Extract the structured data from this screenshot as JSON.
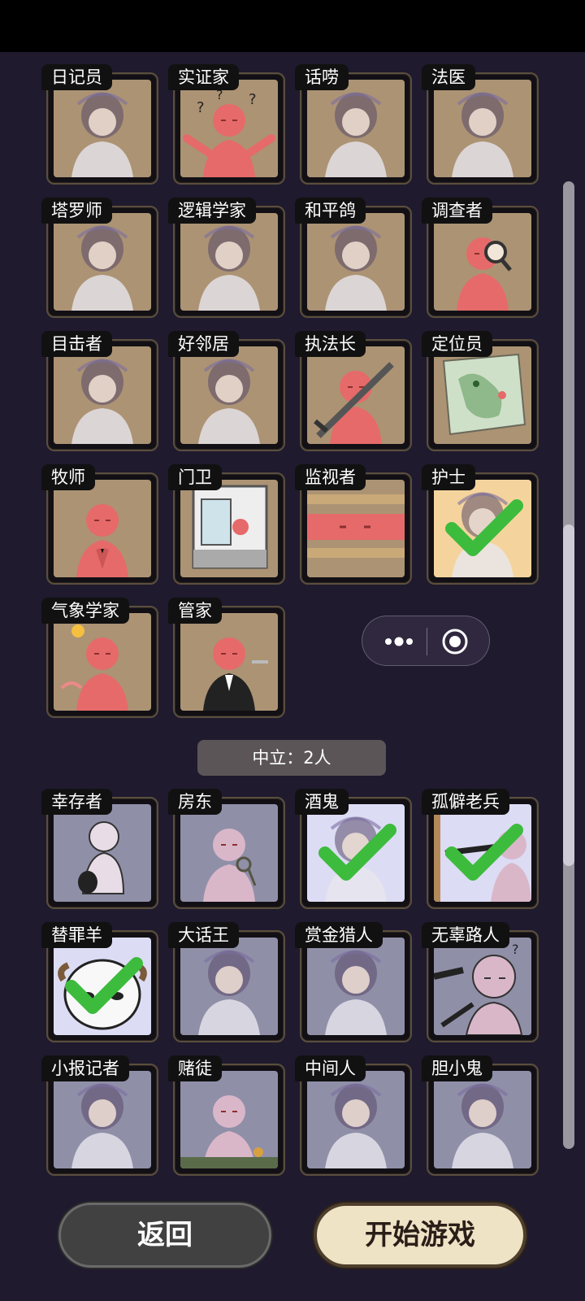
{
  "good_roles": [
    {
      "label": "日记员",
      "picked": false,
      "icon": "portrait-icon"
    },
    {
      "label": "实证家",
      "picked": false,
      "icon": "confused-figure-icon"
    },
    {
      "label": "话唠",
      "picked": false,
      "icon": "portrait-icon"
    },
    {
      "label": "法医",
      "picked": false,
      "icon": "portrait-icon"
    },
    {
      "label": "塔罗师",
      "picked": false,
      "icon": "portrait-icon"
    },
    {
      "label": "逻辑学家",
      "picked": false,
      "icon": "portrait-icon"
    },
    {
      "label": "和平鸽",
      "picked": false,
      "icon": "portrait-icon"
    },
    {
      "label": "调查者",
      "picked": false,
      "icon": "magnifier-figure-icon"
    },
    {
      "label": "目击者",
      "picked": false,
      "icon": "portrait-icon"
    },
    {
      "label": "好邻居",
      "picked": false,
      "icon": "portrait-icon"
    },
    {
      "label": "执法长",
      "picked": false,
      "icon": "sword-figure-icon"
    },
    {
      "label": "定位员",
      "picked": false,
      "icon": "map-icon"
    },
    {
      "label": "牧师",
      "picked": false,
      "icon": "praying-figure-icon"
    },
    {
      "label": "门卫",
      "picked": false,
      "icon": "door-figure-icon"
    },
    {
      "label": "监视者",
      "picked": false,
      "icon": "peeking-figure-icon"
    },
    {
      "label": "护士",
      "picked": true,
      "icon": "portrait-icon"
    },
    {
      "label": "气象学家",
      "picked": false,
      "icon": "weather-figure-icon"
    },
    {
      "label": "管家",
      "picked": false,
      "icon": "butler-figure-icon"
    }
  ],
  "neutral_banner": "中立：2人",
  "neutral_roles": [
    {
      "label": "幸存者",
      "picked": false,
      "icon": "crouching-figure-icon"
    },
    {
      "label": "房东",
      "picked": false,
      "icon": "keys-figure-icon"
    },
    {
      "label": "酒鬼",
      "picked": true,
      "icon": "portrait-icon"
    },
    {
      "label": "孤僻老兵",
      "picked": true,
      "icon": "gun-figure-icon"
    },
    {
      "label": "替罪羊",
      "picked": true,
      "icon": "sheep-icon"
    },
    {
      "label": "大话王",
      "picked": false,
      "icon": "portrait-icon"
    },
    {
      "label": "赏金猎人",
      "picked": false,
      "icon": "portrait-icon"
    },
    {
      "label": "无辜路人",
      "picked": false,
      "icon": "gun-pointed-figure-icon"
    },
    {
      "label": "小报记者",
      "picked": false,
      "icon": "portrait-icon"
    },
    {
      "label": "赌徒",
      "picked": false,
      "icon": "gambler-figure-icon"
    },
    {
      "label": "中间人",
      "picked": false,
      "icon": "portrait-icon"
    },
    {
      "label": "胆小鬼",
      "picked": false,
      "icon": "portrait-icon"
    }
  ],
  "buttons": {
    "back": "返回",
    "start": "开始游戏"
  },
  "colors": {
    "good_tile": "#d7b88a",
    "neutral_tile": "#b3b3cc",
    "check": "#3dbb3d",
    "figure_good": "#e66a6a",
    "figure_neutral": "#d9b7c9"
  }
}
